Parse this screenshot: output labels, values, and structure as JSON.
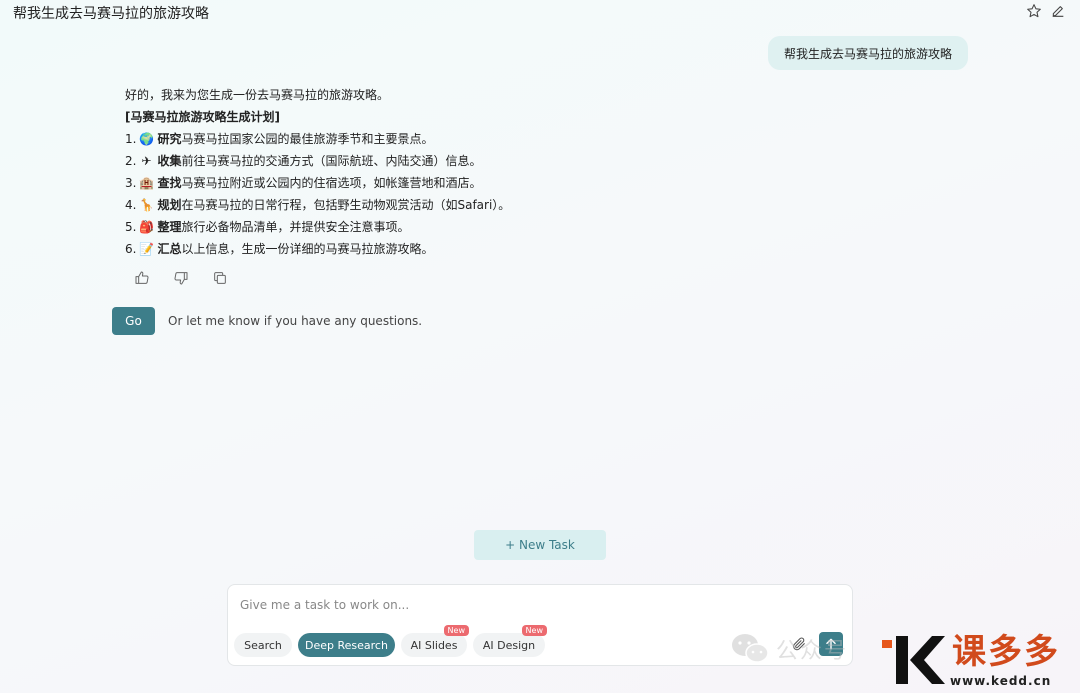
{
  "header": {
    "title": "帮我生成去马赛马拉的旅游攻略",
    "star_icon": "star-icon",
    "edit_icon": "edit-icon"
  },
  "user_message": "帮我生成去马赛马拉的旅游攻略",
  "reply": {
    "intro": "好的，我来为您生成一份去马赛马拉的旅游攻略。",
    "plan_title": "[马赛马拉旅游攻略生成计划]",
    "steps": [
      {
        "num": "1.",
        "emoji": "🌍",
        "verb": "研究",
        "text": "马赛马拉国家公园的最佳旅游季节和主要景点。"
      },
      {
        "num": "2.",
        "emoji": "✈",
        "verb": "收集",
        "text": "前往马赛马拉的交通方式（国际航班、内陆交通）信息。"
      },
      {
        "num": "3.",
        "emoji": "🏨",
        "verb": "查找",
        "text": "马赛马拉附近或公园内的住宿选项，如帐篷营地和酒店。"
      },
      {
        "num": "4.",
        "emoji": "🦒",
        "verb": "规划",
        "text": "在马赛马拉的日常行程，包括野生动物观赏活动（如Safari）。"
      },
      {
        "num": "5.",
        "emoji": "🎒",
        "verb": "整理",
        "text": "旅行必备物品清单，并提供安全注意事项。"
      },
      {
        "num": "6.",
        "emoji": "📝",
        "verb": "汇总",
        "text": "以上信息，生成一份详细的马赛马拉旅游攻略。"
      }
    ]
  },
  "actions": {
    "go_label": "Go",
    "hint": "Or let me know if you have any questions."
  },
  "new_task_label": "+ New Task",
  "composer": {
    "placeholder": "Give me a task to work on...",
    "chips": [
      {
        "label": "Search",
        "badge": ""
      },
      {
        "label": "Deep Research",
        "badge": ""
      },
      {
        "label": "AI Slides",
        "badge": "New"
      },
      {
        "label": "AI Design",
        "badge": "New"
      }
    ]
  },
  "watermark": {
    "wechat_text": "公众号",
    "logo_text": "课多多",
    "logo_url": "www.kedd.cn"
  },
  "colors": {
    "accent": "#3d7e8a",
    "user_bubble": "#dff1f1",
    "badge": "#ec6a6f"
  }
}
